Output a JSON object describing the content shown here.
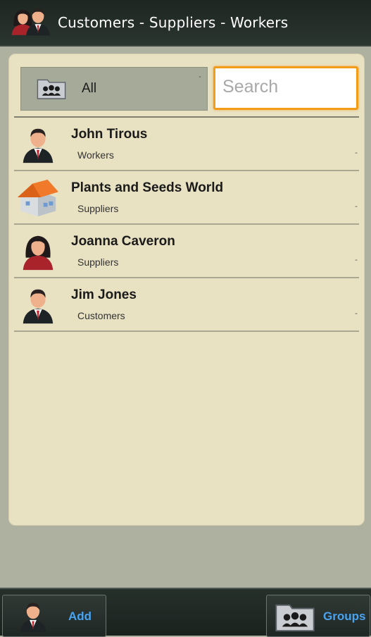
{
  "header": {
    "title": "Customers - Suppliers - Workers",
    "icon": "people-icon"
  },
  "filter": {
    "group_label": "All",
    "group_dash": "-",
    "search_placeholder": "Search"
  },
  "contacts": [
    {
      "name": "John Tirous",
      "group": "Workers",
      "dash": "-",
      "icon": "man-avatar-icon"
    },
    {
      "name": "Plants and Seeds World",
      "group": "Suppliers",
      "dash": "-",
      "icon": "building-icon"
    },
    {
      "name": "Joanna Caveron",
      "group": "Suppliers",
      "dash": "-",
      "icon": "woman-avatar-icon"
    },
    {
      "name": "Jim Jones",
      "group": "Customers",
      "dash": "-",
      "icon": "man-avatar-icon"
    }
  ],
  "toolbar": {
    "add_label": "Add",
    "groups_label": "Groups"
  },
  "colors": {
    "accent": "#4aa3f0",
    "search_border": "#f39c1a",
    "card": "#e8e1c2"
  }
}
